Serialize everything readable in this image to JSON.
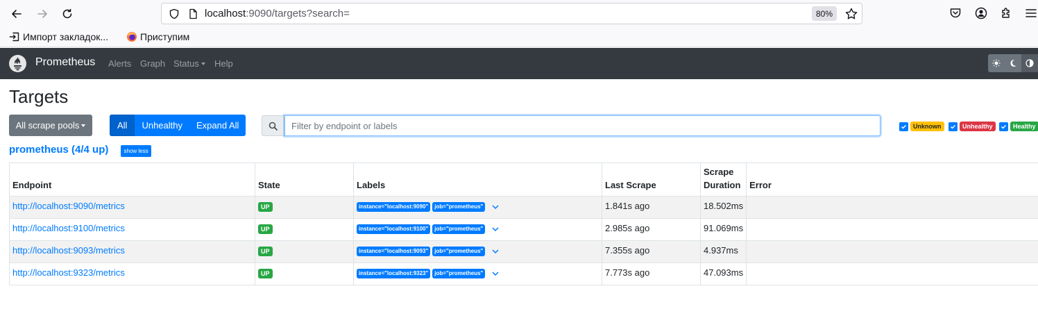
{
  "browser": {
    "url_host": "localhost",
    "url_rest": ":9090/targets?search=",
    "zoom": "80%",
    "bookmarks": [
      {
        "label": "Импорт закладок...",
        "icon": "import-icon"
      },
      {
        "label": "Приступим",
        "icon": "firefox-icon"
      }
    ]
  },
  "navbar": {
    "brand": "Prometheus",
    "links": [
      "Alerts",
      "Graph",
      "Status",
      "Help"
    ]
  },
  "page": {
    "title": "Targets",
    "scrape_pools_button": "All scrape pools",
    "filter_buttons": {
      "all": "All",
      "unhealthy": "Unhealthy",
      "expand_all": "Expand All"
    },
    "search_placeholder": "Filter by endpoint or labels",
    "health_filters": [
      {
        "label": "Unknown",
        "color": "#ffc107",
        "text_color": "#212529",
        "checked": true
      },
      {
        "label": "Unhealthy",
        "color": "#dc3545",
        "text_color": "#ffffff",
        "checked": true
      },
      {
        "label": "Healthy",
        "color": "#28a745",
        "text_color": "#ffffff",
        "checked": true
      }
    ]
  },
  "pool": {
    "title": "prometheus (4/4 up)",
    "toggle_label": "show less",
    "columns": {
      "endpoint": "Endpoint",
      "state": "State",
      "labels": "Labels",
      "last_scrape": "Last Scrape",
      "scrape_duration_1": "Scrape",
      "scrape_duration_2": "Duration",
      "error": "Error"
    },
    "rows": [
      {
        "endpoint": "http://localhost:9090/metrics",
        "state": "UP",
        "instance": "instance=\"localhost:9090\"",
        "job": "job=\"prometheus\"",
        "last_scrape": "1.841s ago",
        "duration": "18.502ms",
        "error": ""
      },
      {
        "endpoint": "http://localhost:9100/metrics",
        "state": "UP",
        "instance": "instance=\"localhost:9100\"",
        "job": "job=\"prometheus\"",
        "last_scrape": "2.985s ago",
        "duration": "91.069ms",
        "error": ""
      },
      {
        "endpoint": "http://localhost:9093/metrics",
        "state": "UP",
        "instance": "instance=\"localhost:9093\"",
        "job": "job=\"prometheus\"",
        "last_scrape": "7.355s ago",
        "duration": "4.937ms",
        "error": ""
      },
      {
        "endpoint": "http://localhost:9323/metrics",
        "state": "UP",
        "instance": "instance=\"localhost:9323\"",
        "job": "job=\"prometheus\"",
        "last_scrape": "7.773s ago",
        "duration": "47.093ms",
        "error": ""
      }
    ]
  },
  "colors": {
    "navbar_bg": "#343a40",
    "primary": "#007bff",
    "success": "#28a745",
    "secondary": "#6c757d"
  }
}
